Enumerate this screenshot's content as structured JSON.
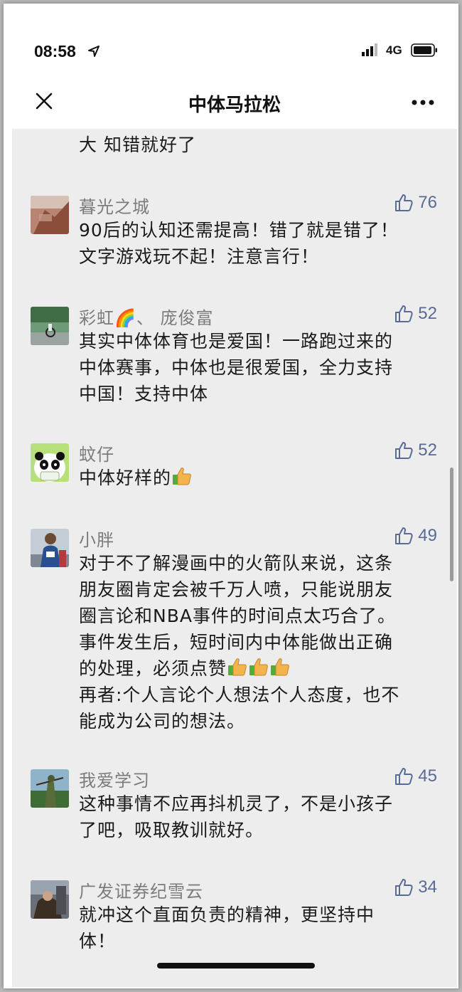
{
  "status_bar": {
    "time": "08:58",
    "network": "4G"
  },
  "nav": {
    "title": "中体马拉松"
  },
  "partial_comment": {
    "text": "大 知错就好了"
  },
  "comments": [
    {
      "name": "暮光之城",
      "likes": "76",
      "lines": [
        "90后的认知还需提高！错了就是错了！",
        "文字游戏玩不起！注意言行！"
      ]
    },
    {
      "name": "彩虹🌈、 庞俊富",
      "likes": "52",
      "lines": [
        "其实中体体育也是爱国！一路跑过来的",
        "中体赛事，中体也是很爱国，全力支持",
        "中国！支持中体"
      ]
    },
    {
      "name": "蚊仔",
      "likes": "52",
      "lines": [
        "中体好样的"
      ]
    },
    {
      "name": "小胖",
      "likes": "49",
      "lines": [
        "对于不了解漫画中的火箭队来说，这条",
        "朋友圈肯定会被千万人喷，只能说朋友",
        "圈言论和NBA事件的时间点太巧合了。",
        "事件发生后，短时间内中体能做出正确",
        "的处理，必须点赞",
        "再者:个人言论个人想法个人态度，也不",
        "能成为公司的想法。"
      ]
    },
    {
      "name": "我爱学习",
      "likes": "45",
      "lines": [
        "这种事情不应再抖机灵了，不是小孩子",
        "了吧，吸取教训就好。"
      ]
    },
    {
      "name": "广发证券纪雪云",
      "likes": "34",
      "lines": [
        "就冲这个直面负责的精神，更坚持中",
        "体！"
      ]
    }
  ]
}
